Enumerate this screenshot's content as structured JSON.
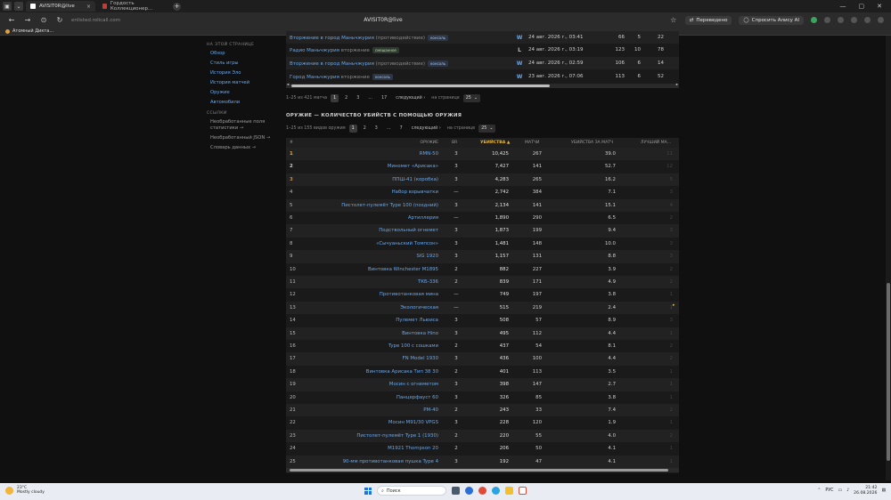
{
  "browser": {
    "tabs": [
      {
        "label": "AVISIT0R@live",
        "active": true
      },
      {
        "label": "Гордость Коллекционер...",
        "active": false
      }
    ],
    "url": "enlisted.rolicall.com",
    "window_title": "AVISIT0R@live",
    "translated_label": "Переведено",
    "ask_alice_label": "Спросить Алису AI",
    "bookmark": "Атомный Дикта..."
  },
  "sidebar": {
    "on_page_heading": "НА ЭТОЙ СТРАНИЦЕ",
    "links": [
      "Обзор",
      "Стиль игры",
      "История Эло",
      "История матчей",
      "Оружие",
      "Автомобили"
    ],
    "links_heading": "ССЫЛКИ",
    "extra": [
      "Необработанные поля статистики →",
      "Необработанный JSON →",
      "Словарь данных →"
    ]
  },
  "matches": {
    "rows": [
      {
        "mode": "Вторжение в город Маньчжурия",
        "suffix": "(противодействие)",
        "badge": "консоль",
        "result": "W",
        "date": "24 авг. 2026 г., 03:41",
        "n1": "66",
        "n2": "5",
        "n3": "22"
      },
      {
        "mode": "Радио Маньчжурия",
        "suffix": "вторжение",
        "badge": "смешанное",
        "result": "L",
        "date": "24 авг. 2026 г., 03:19",
        "n1": "123",
        "n2": "10",
        "n3": "78"
      },
      {
        "mode": "Вторжение в город Маньчжурия",
        "suffix": "(противодействие)",
        "badge": "консоль",
        "result": "W",
        "date": "24 авг. 2026 г., 02:59",
        "n1": "106",
        "n2": "6",
        "n3": "14"
      },
      {
        "mode": "Город Маньчжурия",
        "suffix": "вторжение",
        "badge": "консоль",
        "result": "W",
        "date": "23 авг. 2026 г., 07:06",
        "n1": "113",
        "n2": "6",
        "n3": "52"
      }
    ],
    "pager": {
      "summary": "1–25 из 421 матча",
      "pages": [
        "1",
        "2",
        "3",
        "…",
        "17"
      ],
      "next": "следующий ›",
      "per_page_label": "на странице",
      "per_page": "25"
    }
  },
  "weapons": {
    "title": "ОРУЖИЕ — КОЛИЧЕСТВО УБИЙСТВ С ПОМОЩЬЮ ОРУЖИЯ",
    "pager": {
      "summary": "1–25 из 155 видов оружия",
      "pages": [
        "1",
        "2",
        "3",
        "…",
        "7"
      ],
      "next": "следующий ›",
      "per_page_label": "на странице",
      "per_page": "25"
    },
    "columns": {
      "rank": "#",
      "name": "ОРУЖИЕ",
      "br": "BR",
      "kills": "УБИЙСТВА ▲",
      "matches": "МАТЧИ",
      "kpm": "УБИЙСТВА ЗА МАТЧ",
      "best": "ЛУЧШИЙ МА..."
    },
    "rows": [
      {
        "rank": "1",
        "name": "RMN-50",
        "br": "3",
        "kills": "10,425",
        "matches": "267",
        "kpm": "39.0",
        "best": "11"
      },
      {
        "rank": "2",
        "name": "Миномет «Арисака»",
        "br": "3",
        "kills": "7,427",
        "matches": "141",
        "kpm": "52.7",
        "best": "12"
      },
      {
        "rank": "3",
        "name": "ППШ-41 (коробка)",
        "br": "3",
        "kills": "4,283",
        "matches": "265",
        "kpm": "16.2",
        "best": "5"
      },
      {
        "rank": "4",
        "name": "Набор взрывчатки",
        "br": "—",
        "kills": "2,742",
        "matches": "384",
        "kpm": "7.1",
        "best": "3"
      },
      {
        "rank": "5",
        "name": "Пистолет-пулемёт Type 100 (поздний)",
        "br": "3",
        "kills": "2,134",
        "matches": "141",
        "kpm": "15.1",
        "best": "4"
      },
      {
        "rank": "6",
        "name": "Артиллерия",
        "br": "—",
        "kills": "1,890",
        "matches": "290",
        "kpm": "6.5",
        "best": "2"
      },
      {
        "rank": "7",
        "name": "Подствольный огнемет",
        "br": "3",
        "kills": "1,873",
        "matches": "199",
        "kpm": "9.4",
        "best": "3"
      },
      {
        "rank": "8",
        "name": "«Сычуаньский Томпсон»",
        "br": "3",
        "kills": "1,481",
        "matches": "148",
        "kpm": "10.0",
        "best": "3"
      },
      {
        "rank": "9",
        "name": "SIG 1920",
        "br": "3",
        "kills": "1,157",
        "matches": "131",
        "kpm": "8.8",
        "best": "3"
      },
      {
        "rank": "10",
        "name": "Винтовка Winchester M1895",
        "br": "2",
        "kills": "882",
        "matches": "227",
        "kpm": "3.9",
        "best": "2"
      },
      {
        "rank": "11",
        "name": "ТКБ-336",
        "br": "2",
        "kills": "839",
        "matches": "171",
        "kpm": "4.9",
        "best": "2"
      },
      {
        "rank": "12",
        "name": "Противотанковая мина",
        "br": "—",
        "kills": "749",
        "matches": "197",
        "kpm": "3.8",
        "best": "1"
      },
      {
        "rank": "13",
        "name": "Экологическая",
        "br": "—",
        "kills": "515",
        "matches": "219",
        "kpm": "2.4",
        "best": "1"
      },
      {
        "rank": "14",
        "name": "Пулемет Льюиса",
        "br": "3",
        "kills": "508",
        "matches": "57",
        "kpm": "8.9",
        "best": "3"
      },
      {
        "rank": "15",
        "name": "Винтовка Hino",
        "br": "3",
        "kills": "495",
        "matches": "112",
        "kpm": "4.4",
        "best": "1"
      },
      {
        "rank": "16",
        "name": "Type 100 с сошками",
        "br": "2",
        "kills": "437",
        "matches": "54",
        "kpm": "8.1",
        "best": "2"
      },
      {
        "rank": "17",
        "name": "FN Model 1930",
        "br": "3",
        "kills": "436",
        "matches": "100",
        "kpm": "4.4",
        "best": "2"
      },
      {
        "rank": "18",
        "name": "Винтовка Арисака Тип 38 30",
        "br": "2",
        "kills": "401",
        "matches": "113",
        "kpm": "3.5",
        "best": "1"
      },
      {
        "rank": "19",
        "name": "Мосин с огнеметом",
        "br": "3",
        "kills": "398",
        "matches": "147",
        "kpm": "2.7",
        "best": "1"
      },
      {
        "rank": "20",
        "name": "Панцерфауст 60",
        "br": "3",
        "kills": "326",
        "matches": "85",
        "kpm": "3.8",
        "best": "1"
      },
      {
        "rank": "21",
        "name": "PM-40",
        "br": "2",
        "kills": "243",
        "matches": "33",
        "kpm": "7.4",
        "best": "2"
      },
      {
        "rank": "22",
        "name": "Мосин M91/30 VPGS",
        "br": "3",
        "kills": "228",
        "matches": "120",
        "kpm": "1.9",
        "best": "1"
      },
      {
        "rank": "23",
        "name": "Пистолет-пулемёт Type 1 (1930)",
        "br": "2",
        "kills": "220",
        "matches": "55",
        "kpm": "4.0",
        "best": "2"
      },
      {
        "rank": "24",
        "name": "M1921 Thompson 20",
        "br": "2",
        "kills": "206",
        "matches": "50",
        "kpm": "4.1",
        "best": "1"
      },
      {
        "rank": "25",
        "name": "90-мм противотанковая пушка Type 4",
        "br": "3",
        "kills": "192",
        "matches": "47",
        "kpm": "4.1",
        "best": "1"
      }
    ]
  },
  "taskbar": {
    "temp": "23°C",
    "weather": "Mostly cloudy",
    "search_placeholder": "Поиск",
    "lang": "РУС",
    "time": "21:42",
    "date": "26.08.2026"
  },
  "colors": {
    "link": "#6aa6e8",
    "gold": "#e3b53b",
    "sort_accent": "#e3b53b"
  }
}
